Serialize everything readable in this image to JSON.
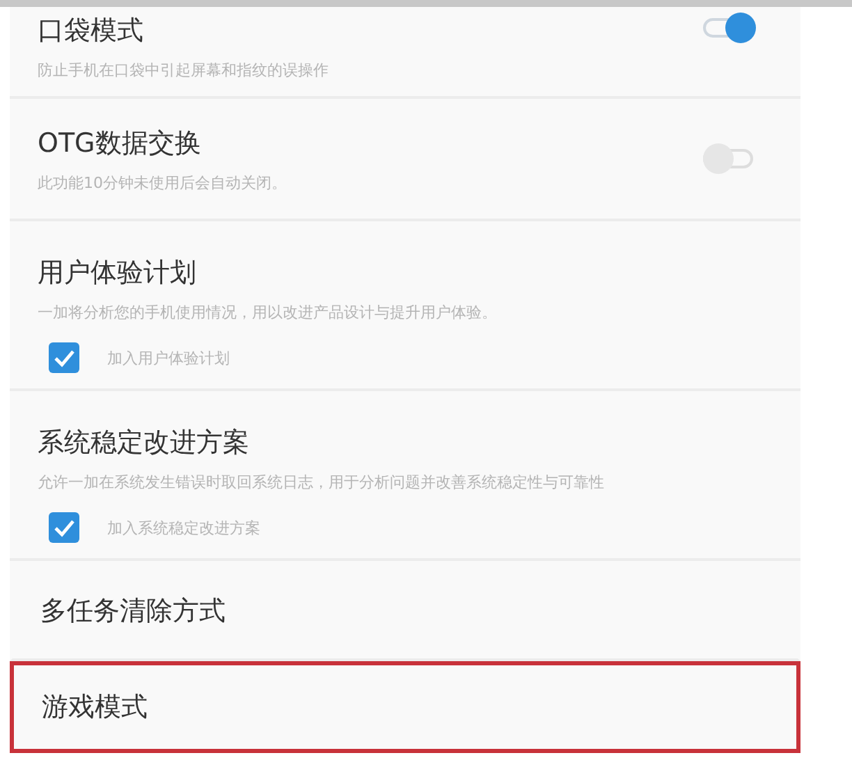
{
  "settings": [
    {
      "kind": "toggle",
      "title": "口袋模式",
      "description": "防止手机在口袋中引起屏幕和指纹的误操作",
      "on": true
    },
    {
      "kind": "toggle",
      "title": "OTG数据交换",
      "description": "此功能10分钟未使用后会自动关闭。",
      "on": false
    },
    {
      "kind": "checkbox",
      "title": "用户体验计划",
      "description": "一加将分析您的手机使用情况，用以改进产品设计与提升用户体验。",
      "option": "加入用户体验计划",
      "checked": true
    },
    {
      "kind": "checkbox",
      "title": "系统稳定改进方案",
      "description": "允许一加在系统发生错误时取回系统日志，用于分析问题并改善系统稳定性与可靠性",
      "option": "加入系统稳定改进方案",
      "checked": true
    },
    {
      "kind": "link",
      "title": "多任务清除方式",
      "highlighted": false
    },
    {
      "kind": "link",
      "title": "游戏模式",
      "highlighted": true
    }
  ]
}
